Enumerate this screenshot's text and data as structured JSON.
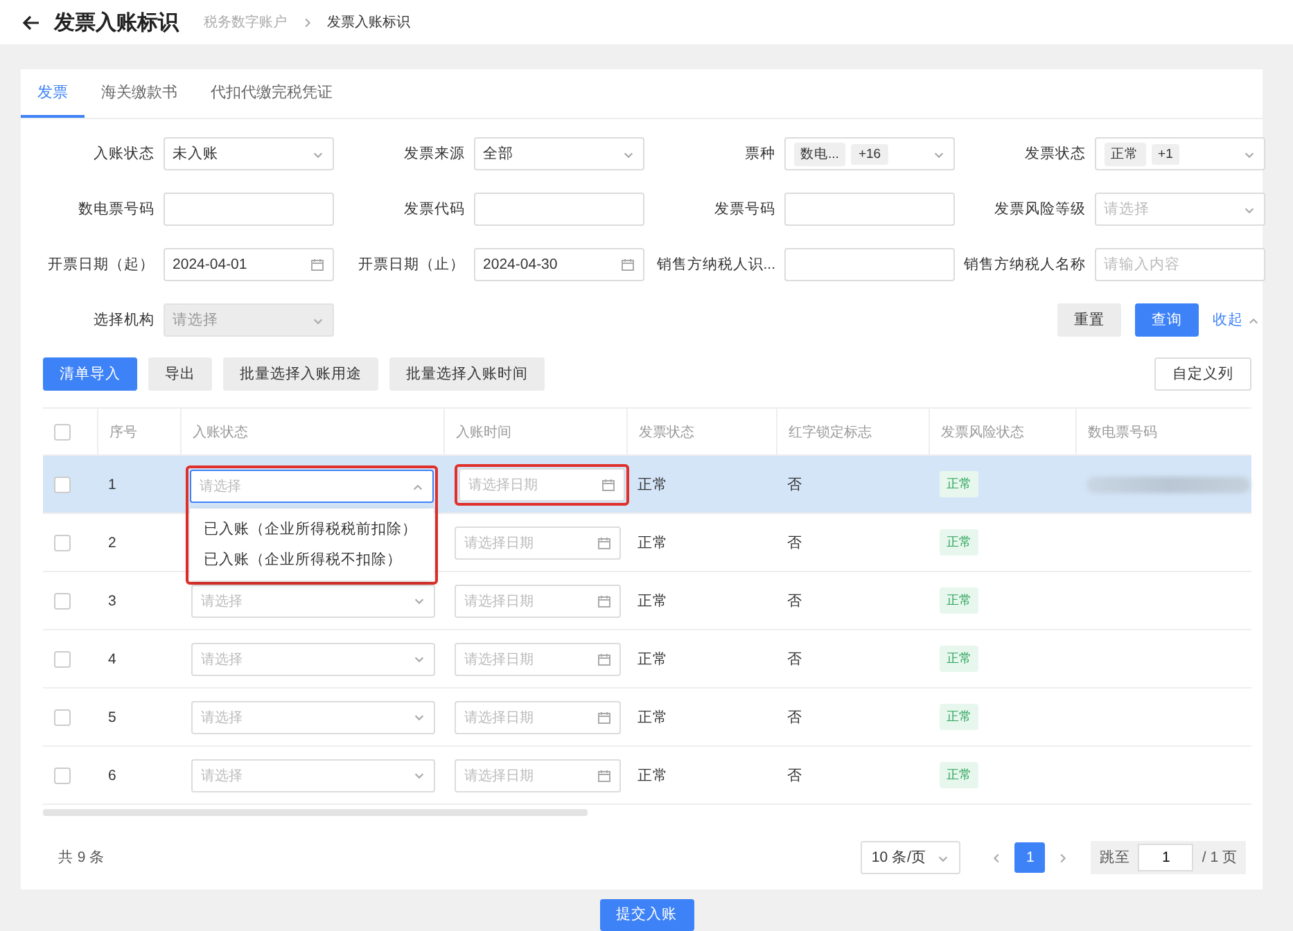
{
  "header": {
    "title": "发票入账标识",
    "breadcrumb": [
      {
        "label": "税务数字账户",
        "current": false
      },
      {
        "label": "发票入账标识",
        "current": true
      }
    ]
  },
  "tabs": [
    {
      "label": "发票",
      "selected": true
    },
    {
      "label": "海关缴款书",
      "selected": false
    },
    {
      "label": "代扣代缴完税凭证",
      "selected": false
    }
  ],
  "filters": [
    {
      "label": "入账状态",
      "kind": "select",
      "value": "未入账",
      "disabled": false
    },
    {
      "label": "发票来源",
      "kind": "select",
      "value": "全部",
      "disabled": false
    },
    {
      "label": "票种",
      "kind": "tags",
      "tags": [
        "数电...",
        "+16"
      ],
      "disabled": false
    },
    {
      "label": "发票状态",
      "kind": "tags",
      "tags": [
        "正常",
        "+1"
      ],
      "disabled": false
    },
    {
      "label": "数电票号码",
      "kind": "input",
      "disabled": false
    },
    {
      "label": "发票代码",
      "kind": "input",
      "disabled": false
    },
    {
      "label": "发票号码",
      "kind": "input",
      "disabled": false
    },
    {
      "label": "发票风险等级",
      "kind": "select",
      "placeholder": "请选择",
      "disabled": false
    },
    {
      "label": "开票日期（起）",
      "kind": "date",
      "value": "2024-04-01",
      "disabled": false
    },
    {
      "label": "开票日期（止）",
      "kind": "date",
      "value": "2024-04-30",
      "disabled": false
    },
    {
      "label": "销售方纳税人识...",
      "kind": "input",
      "disabled": false
    },
    {
      "label": "销售方纳税人名称",
      "kind": "input",
      "placeholder": "请输入内容",
      "disabled": false
    },
    {
      "label": "选择机构",
      "kind": "select",
      "placeholder": "请选择",
      "disabled": true
    }
  ],
  "filter_actions": {
    "reset": "重置",
    "search": "查询",
    "collapse": "收起"
  },
  "toolbar": {
    "buttons": [
      {
        "label": "清单导入",
        "primary": true
      },
      {
        "label": "导出",
        "primary": false
      },
      {
        "label": "批量选择入账用途",
        "primary": false
      },
      {
        "label": "批量选择入账时间",
        "primary": false
      }
    ],
    "custom_columns": "自定义列"
  },
  "table": {
    "header_checked": false,
    "columns": [
      "序号",
      "入账状态",
      "入账时间",
      "发票状态",
      "红字锁定标志",
      "发票风险状态",
      "数电票号码"
    ],
    "rows": [
      {
        "index": "1",
        "checked": false,
        "active": true,
        "open": true,
        "annotated": true,
        "status_placeholder": "请选择",
        "date_placeholder": "请选择日期",
        "invoice_status": "正常",
        "red_lock": "否",
        "risk_status": "正常",
        "number_redacted": true
      },
      {
        "index": "2",
        "checked": false,
        "active": false,
        "open": false,
        "annotated": false,
        "date_placeholder": "请选择日期",
        "invoice_status": "正常",
        "red_lock": "否",
        "risk_status": "正常",
        "number_redacted": false
      },
      {
        "index": "3",
        "checked": false,
        "active": false,
        "open": false,
        "annotated": false,
        "status_placeholder": "请选择",
        "date_placeholder": "请选择日期",
        "invoice_status": "正常",
        "red_lock": "否",
        "risk_status": "正常",
        "number_redacted": false
      },
      {
        "index": "4",
        "checked": false,
        "active": false,
        "open": false,
        "annotated": false,
        "status_placeholder": "请选择",
        "date_placeholder": "请选择日期",
        "invoice_status": "正常",
        "red_lock": "否",
        "risk_status": "正常",
        "number_redacted": false
      },
      {
        "index": "5",
        "checked": false,
        "active": false,
        "open": false,
        "annotated": false,
        "status_placeholder": "请选择",
        "date_placeholder": "请选择日期",
        "invoice_status": "正常",
        "red_lock": "否",
        "risk_status": "正常",
        "number_redacted": false
      },
      {
        "index": "6",
        "checked": false,
        "active": false,
        "open": false,
        "annotated": false,
        "status_placeholder": "请选择",
        "date_placeholder": "请选择日期",
        "invoice_status": "正常",
        "red_lock": "否",
        "risk_status": "正常",
        "number_redacted": false
      }
    ],
    "dropdown_options": [
      "已入账（企业所得税税前扣除）",
      "已入账（企业所得税不扣除）"
    ]
  },
  "footer": {
    "total": "共 9 条",
    "page_size": "10 条/页",
    "pages": [
      {
        "label": "1",
        "selected": true
      }
    ],
    "jump_label": "跳至",
    "jump_value": "1",
    "page_total": "/ 1 页"
  },
  "submit": "提交入账"
}
